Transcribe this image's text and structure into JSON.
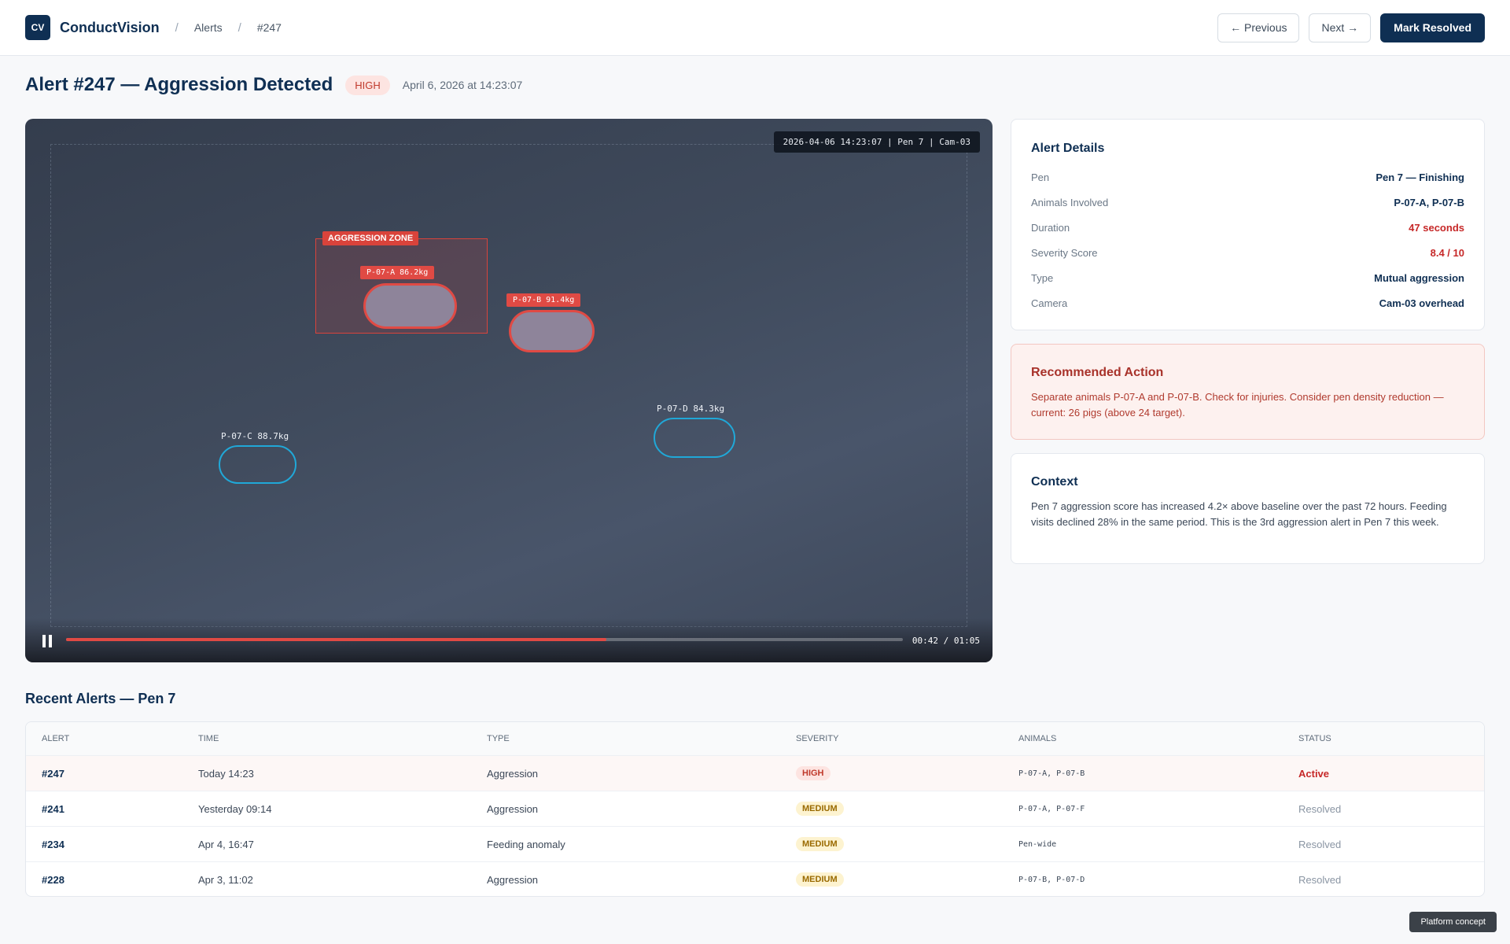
{
  "header": {
    "logo": "CV",
    "app_name": "ConductVision",
    "breadcrumb": [
      "Alerts",
      "#247"
    ],
    "prev_label": "← Previous",
    "next_label": "Next →",
    "resolve_label": "Mark Resolved"
  },
  "alert": {
    "title": "Alert #247 — Aggression Detected",
    "severity": "HIGH",
    "timestamp": "April 6, 2026 at 14:23:07"
  },
  "video": {
    "stamp": "2026-04-06 14:23:07 | Pen 7 | Cam-03",
    "zone_label": "AGGRESSION ZONE",
    "animals": [
      {
        "id": "P-07-A",
        "label": "P-07-A 86.2kg",
        "flagged": true
      },
      {
        "id": "P-07-B",
        "label": "P-07-B 91.4kg",
        "flagged": true
      },
      {
        "id": "P-07-C",
        "label": "P-07-C 88.7kg",
        "flagged": false
      },
      {
        "id": "P-07-D",
        "label": "P-07-D 84.3kg",
        "flagged": false
      }
    ],
    "progress": 0.6458,
    "time_readout": "00:42 / 01:05",
    "icons": {
      "pause": "pause-icon"
    }
  },
  "details": {
    "title": "Alert Details",
    "rows": [
      {
        "label": "Pen",
        "value": "Pen 7 — Finishing"
      },
      {
        "label": "Animals Involved",
        "value": "P-07-A, P-07-B"
      },
      {
        "label": "Duration",
        "value": "47 seconds"
      },
      {
        "label": "Severity Score",
        "value": "8.4 / 10"
      },
      {
        "label": "Type",
        "value": "Mutual aggression"
      },
      {
        "label": "Camera",
        "value": "Cam-03 overhead"
      }
    ]
  },
  "recommended": {
    "title": "Recommended Action",
    "text": "Separate animals P-07-A and P-07-B. Check for injuries. Consider pen density reduction — current: 26 pigs (above 24 target)."
  },
  "context": {
    "title": "Context",
    "text": "Pen 7 aggression score has increased 4.2× above baseline over the past 72 hours. Feeding visits declined 28% in the same period. This is the 3rd aggression alert in Pen 7 this week."
  },
  "recent": {
    "title": "Recent Alerts — Pen 7",
    "columns": [
      "ALERT",
      "TIME",
      "TYPE",
      "SEVERITY",
      "ANIMALS",
      "STATUS"
    ],
    "rows": [
      {
        "id": "#247",
        "time": "Today 14:23",
        "type": "Aggression",
        "severity": "HIGH",
        "animals": "P-07-A, P-07-B",
        "status": "Active"
      },
      {
        "id": "#241",
        "time": "Yesterday 09:14",
        "type": "Aggression",
        "severity": "MEDIUM",
        "animals": "P-07-A, P-07-F",
        "status": "Resolved"
      },
      {
        "id": "#234",
        "time": "Apr 4, 16:47",
        "type": "Feeding anomaly",
        "severity": "MEDIUM",
        "animals": "Pen-wide",
        "status": "Resolved"
      },
      {
        "id": "#228",
        "time": "Apr 3, 11:02",
        "type": "Aggression",
        "severity": "MEDIUM",
        "animals": "P-07-B, P-07-D",
        "status": "Resolved"
      }
    ]
  },
  "footer": {
    "tag": "Platform concept"
  }
}
